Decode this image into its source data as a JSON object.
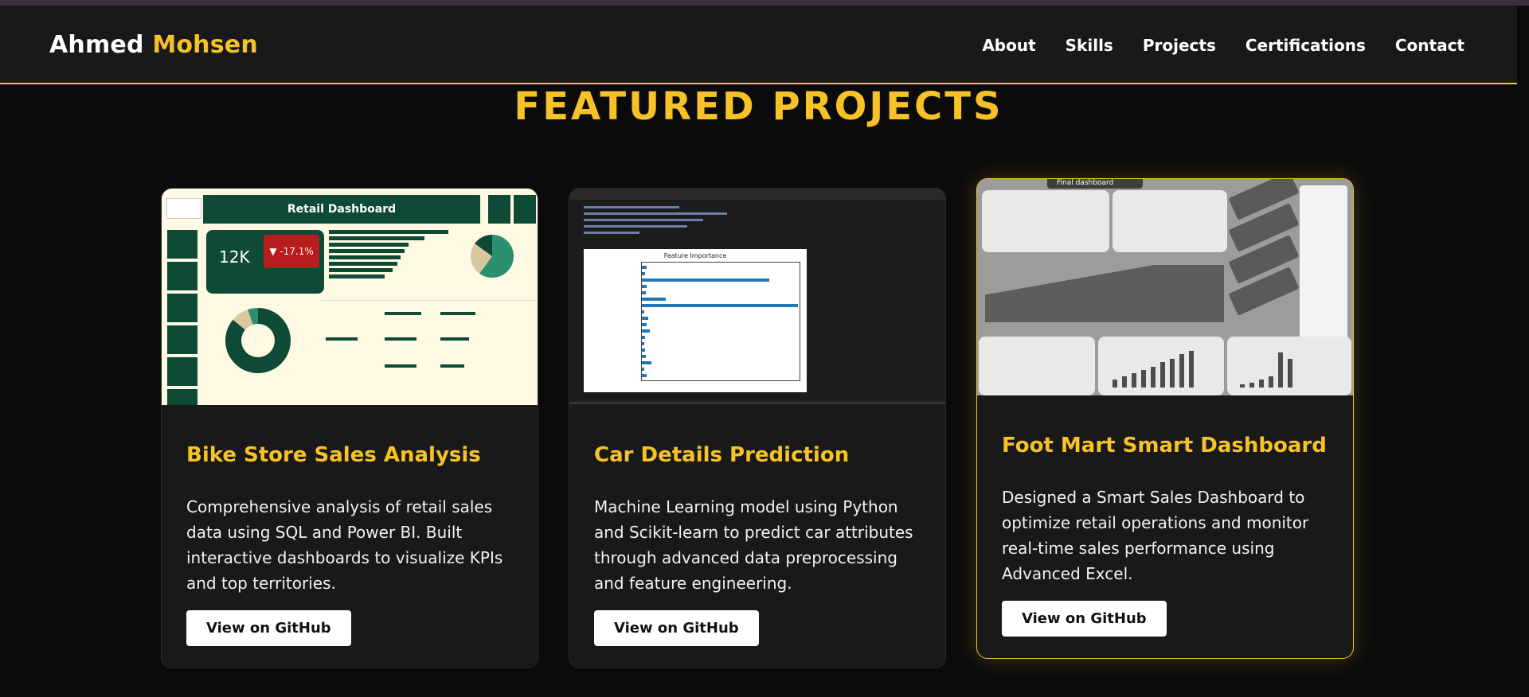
{
  "nav": {
    "logo_first": "Ahmed",
    "logo_second": "Mohsen",
    "links": [
      "About",
      "Skills",
      "Projects",
      "Certifications",
      "Contact"
    ]
  },
  "section": {
    "title": "FEATURED PROJECTS"
  },
  "projects": [
    {
      "title": "Bike Store Sales Analysis",
      "description": "Comprehensive analysis of retail sales data using SQL and Power BI. Built interactive dashboards to visualize KPIs and top territories.",
      "button": "View on GitHub",
      "thumbnail": {
        "header": "Retail Dashboard",
        "kpi_value": "12K",
        "kpi_change": "▼ -17.1%"
      }
    },
    {
      "title": "Car Details Prediction",
      "description": "Machine Learning model using Python and Scikit-learn to predict car attributes through advanced data preprocessing and feature engineering.",
      "button": "View on GitHub",
      "thumbnail": {
        "plot_title": "Feature Importance"
      }
    },
    {
      "title": "Foot Mart Smart Dashboard",
      "description": "Designed a Smart Sales Dashboard to optimize retail operations and monitor real-time sales performance using Advanced Excel.",
      "button": "View on GitHub",
      "thumbnail": {
        "header": "Final dashboard"
      }
    }
  ],
  "colors": {
    "accent": "#f6c228",
    "card_bg": "#191919",
    "page_bg": "#0b0b0b"
  }
}
